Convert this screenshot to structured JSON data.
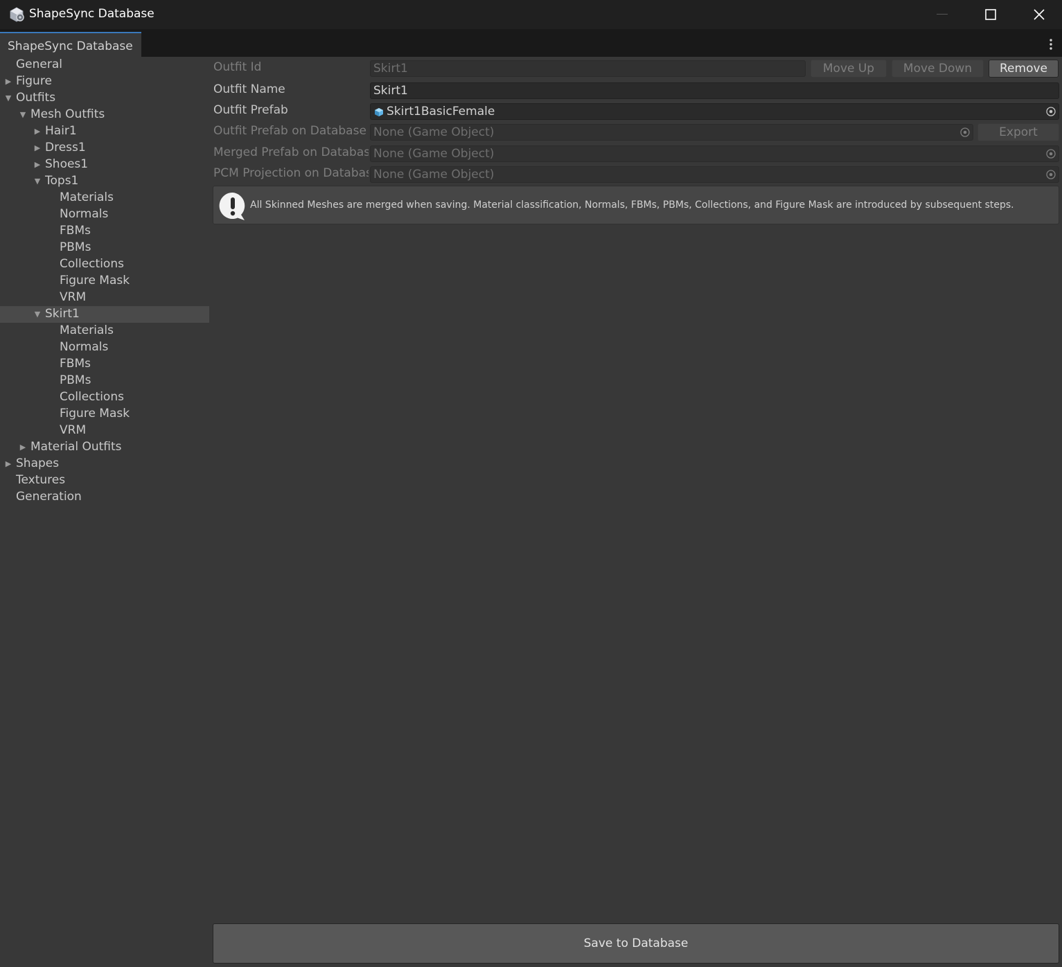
{
  "window": {
    "title": "ShapeSync Database"
  },
  "tab": {
    "label": "ShapeSync Database"
  },
  "sidebar": {
    "items": [
      {
        "label": "General",
        "depth": 0,
        "expander": "none",
        "selected": false
      },
      {
        "label": "Figure",
        "depth": 0,
        "expander": "collapsed",
        "selected": false
      },
      {
        "label": "Outfits",
        "depth": 0,
        "expander": "expanded",
        "selected": false
      },
      {
        "label": "Mesh Outfits",
        "depth": 1,
        "expander": "expanded",
        "selected": false
      },
      {
        "label": "Hair1",
        "depth": 2,
        "expander": "collapsed",
        "selected": false
      },
      {
        "label": "Dress1",
        "depth": 2,
        "expander": "collapsed",
        "selected": false
      },
      {
        "label": "Shoes1",
        "depth": 2,
        "expander": "collapsed",
        "selected": false
      },
      {
        "label": "Tops1",
        "depth": 2,
        "expander": "expanded",
        "selected": false
      },
      {
        "label": "Materials",
        "depth": 3,
        "expander": "none",
        "selected": false
      },
      {
        "label": "Normals",
        "depth": 3,
        "expander": "none",
        "selected": false
      },
      {
        "label": "FBMs",
        "depth": 3,
        "expander": "none",
        "selected": false
      },
      {
        "label": "PBMs",
        "depth": 3,
        "expander": "none",
        "selected": false
      },
      {
        "label": "Collections",
        "depth": 3,
        "expander": "none",
        "selected": false
      },
      {
        "label": "Figure Mask",
        "depth": 3,
        "expander": "none",
        "selected": false
      },
      {
        "label": "VRM",
        "depth": 3,
        "expander": "none",
        "selected": false
      },
      {
        "label": "Skirt1",
        "depth": 2,
        "expander": "expanded",
        "selected": true
      },
      {
        "label": "Materials",
        "depth": 3,
        "expander": "none",
        "selected": false
      },
      {
        "label": "Normals",
        "depth": 3,
        "expander": "none",
        "selected": false
      },
      {
        "label": "FBMs",
        "depth": 3,
        "expander": "none",
        "selected": false
      },
      {
        "label": "PBMs",
        "depth": 3,
        "expander": "none",
        "selected": false
      },
      {
        "label": "Collections",
        "depth": 3,
        "expander": "none",
        "selected": false
      },
      {
        "label": "Figure Mask",
        "depth": 3,
        "expander": "none",
        "selected": false
      },
      {
        "label": "VRM",
        "depth": 3,
        "expander": "none",
        "selected": false
      },
      {
        "label": "Material Outfits",
        "depth": 1,
        "expander": "collapsed",
        "selected": false
      },
      {
        "label": "Shapes",
        "depth": 0,
        "expander": "collapsed",
        "selected": false
      },
      {
        "label": "Textures",
        "depth": 0,
        "expander": "none",
        "selected": false
      },
      {
        "label": "Generation",
        "depth": 0,
        "expander": "none",
        "selected": false
      }
    ]
  },
  "form": {
    "outfit_id": {
      "label": "Outfit Id",
      "value": "Skirt1"
    },
    "move_up": "Move Up",
    "move_down": "Move Down",
    "remove": "Remove",
    "outfit_name": {
      "label": "Outfit Name",
      "value": "Skirt1"
    },
    "outfit_prefab": {
      "label": "Outfit Prefab",
      "value": "Skirt1BasicFemale"
    },
    "outfit_prefab_db": {
      "label": "Outfit Prefab on Database",
      "value": "None (Game Object)"
    },
    "export": "Export",
    "merged_prefab_db": {
      "label": "Merged Prefab on Database",
      "value": "None (Game Object)"
    },
    "pcm_projection_db": {
      "label": "PCM Projection on Database",
      "value": "None (Game Object)"
    }
  },
  "help": {
    "text": "All Skinned Meshes are merged when saving. Material classification, Normals, FBMs, PBMs, Collections, and Figure Mask are introduced by subsequent steps."
  },
  "save_button": "Save to Database",
  "colors": {
    "accent": "#3a79bb",
    "background": "#383838",
    "titlebar": "#202020",
    "selected": "#4a4a4a"
  }
}
